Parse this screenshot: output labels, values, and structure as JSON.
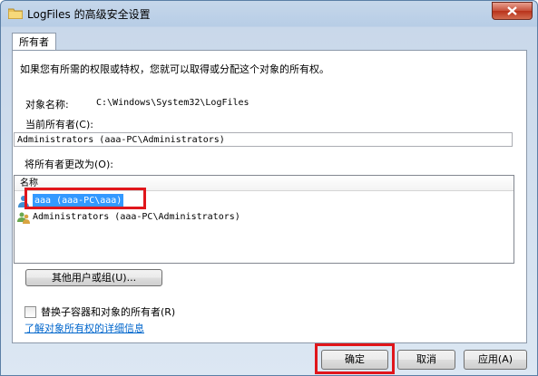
{
  "window": {
    "title": "LogFiles 的高级安全设置",
    "accent_close": "#c7503a"
  },
  "tabs": [
    {
      "label": "所有者",
      "selected": true
    }
  ],
  "panel": {
    "description": "如果您有所需的权限或特权，您就可以取得或分配这个对象的所有权。",
    "object_name_label": "对象名称:",
    "object_name_value": "C:\\Windows\\System32\\LogFiles",
    "current_owner_label": "当前所有者(C):",
    "current_owner_value": "Administrators (aaa-PC\\Administrators)",
    "change_owner_label": "将所有者更改为(O):",
    "list": {
      "column_header": "名称",
      "items": [
        {
          "text": "aaa (aaa-PC\\aaa)",
          "selected": true
        },
        {
          "text": "Administrators (aaa-PC\\Administrators)",
          "selected": false
        }
      ]
    },
    "other_users_button": "其他用户或组(U)...",
    "replace_checkbox_label": "替换子容器和对象的所有者(R)",
    "replace_checked": false,
    "learn_more_link": "了解对象所有权的详细信息"
  },
  "footer": {
    "ok_button": "确定",
    "cancel_button": "取消",
    "apply_button": "应用(A)"
  },
  "colors": {
    "selection": "#3399ff",
    "highlight": "#e0161b",
    "link": "#0066cc"
  }
}
